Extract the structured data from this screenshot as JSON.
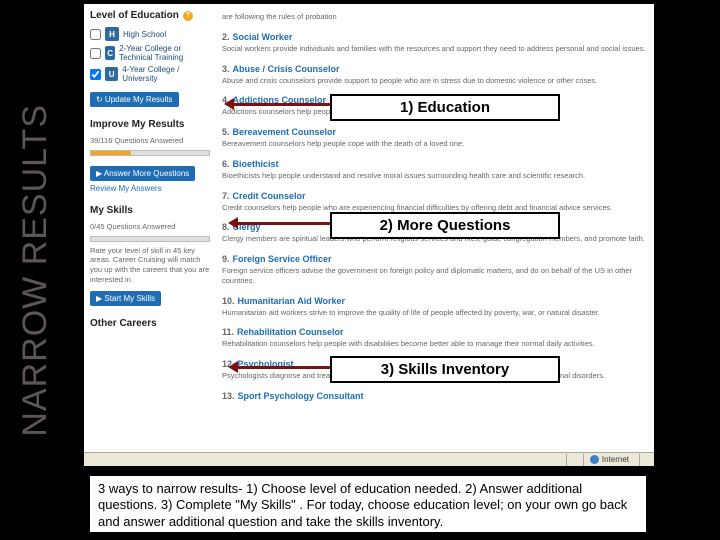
{
  "vertical_title": "NARROW RESULTS",
  "sidebar": {
    "education": {
      "heading": "Level of Education",
      "rows": [
        {
          "badge": "H",
          "label": "High School"
        },
        {
          "badge": "C",
          "label": "2-Year College or Technical Training"
        },
        {
          "badge": "U",
          "label": "4-Year College / University"
        }
      ],
      "update_btn": "↻ Update My Results"
    },
    "improve": {
      "heading": "Improve My Results",
      "progress_label": "39/116 Questions Answered",
      "fill_pct": 34,
      "more_btn": "▶ Answer More Questions",
      "review_link": "Review My Answers"
    },
    "skills": {
      "heading": "My Skills",
      "progress_label": "0/45 Questions Answered",
      "fill_pct": 0,
      "blurb": "Rate your level of skill in 45 key areas. Career Cruising will match you up with the careers that you are interested in.",
      "start_btn": "▶ Start My Skills"
    },
    "other": {
      "heading": "Other Careers"
    }
  },
  "results": [
    {
      "n": "",
      "title": "",
      "desc": "are following the rules of probation"
    },
    {
      "n": "2.",
      "title": "Social Worker",
      "desc": "Social workers provide individuals and families with the resources and support they need to address personal and social issues."
    },
    {
      "n": "3.",
      "title": "Abuse / Crisis Counselor",
      "desc": "Abuse and crisis counselors provide support to people who are in stress due to domestic violence or other crises."
    },
    {
      "n": "4.",
      "title": "Addictions Counselor",
      "desc": "Addictions counselors help people overcome alcohol, drug, gambling, and other addictions."
    },
    {
      "n": "5.",
      "title": "Bereavement Counselor",
      "desc": "Bereavement counselors help people cope with the death of a loved one."
    },
    {
      "n": "6.",
      "title": "Bioethicist",
      "desc": "Bioethicists help people understand and resolve moral issues surrounding health care and scientific research."
    },
    {
      "n": "7.",
      "title": "Credit Counselor",
      "desc": "Credit counselors help people who are experiencing financial difficulties by offering debt and financial advice services."
    },
    {
      "n": "8.",
      "title": "Clergy",
      "desc": "Clergy members are spiritual leaders who perform religious services and rites, guide congregation members, and promote faith."
    },
    {
      "n": "9.",
      "title": "Foreign Service Officer",
      "desc": "Foreign service officers advise the government on foreign policy and diplomatic matters, and do on behalf of the US in other countries."
    },
    {
      "n": "10.",
      "title": "Humanitarian Aid Worker",
      "desc": "Humanitarian aid workers strive to improve the quality of life of people affected by poverty, war, or natural disaster."
    },
    {
      "n": "11.",
      "title": "Rehabilitation Counselor",
      "desc": "Rehabilitation counselors help people with disabilities become better able to manage their normal daily activities."
    },
    {
      "n": "12.",
      "title": "Psychologist",
      "desc": "Psychologists diagnose and treat people affected by personal problems and psychological and emotional disorders."
    },
    {
      "n": "13.",
      "title": "Sport Psychology Consultant",
      "desc": ""
    }
  ],
  "statusbar": {
    "zone": "Internet",
    "zoom": ""
  },
  "callouts": {
    "c1": "1) Education",
    "c2": "2) More Questions",
    "c3": "3) Skills Inventory"
  },
  "caption": "3 ways to narrow results- 1) Choose level of education needed. 2) Answer additional questions. 3) Complete \"My Skills\" . For today, choose education level; on your own go back and answer additional question and take the skills inventory."
}
